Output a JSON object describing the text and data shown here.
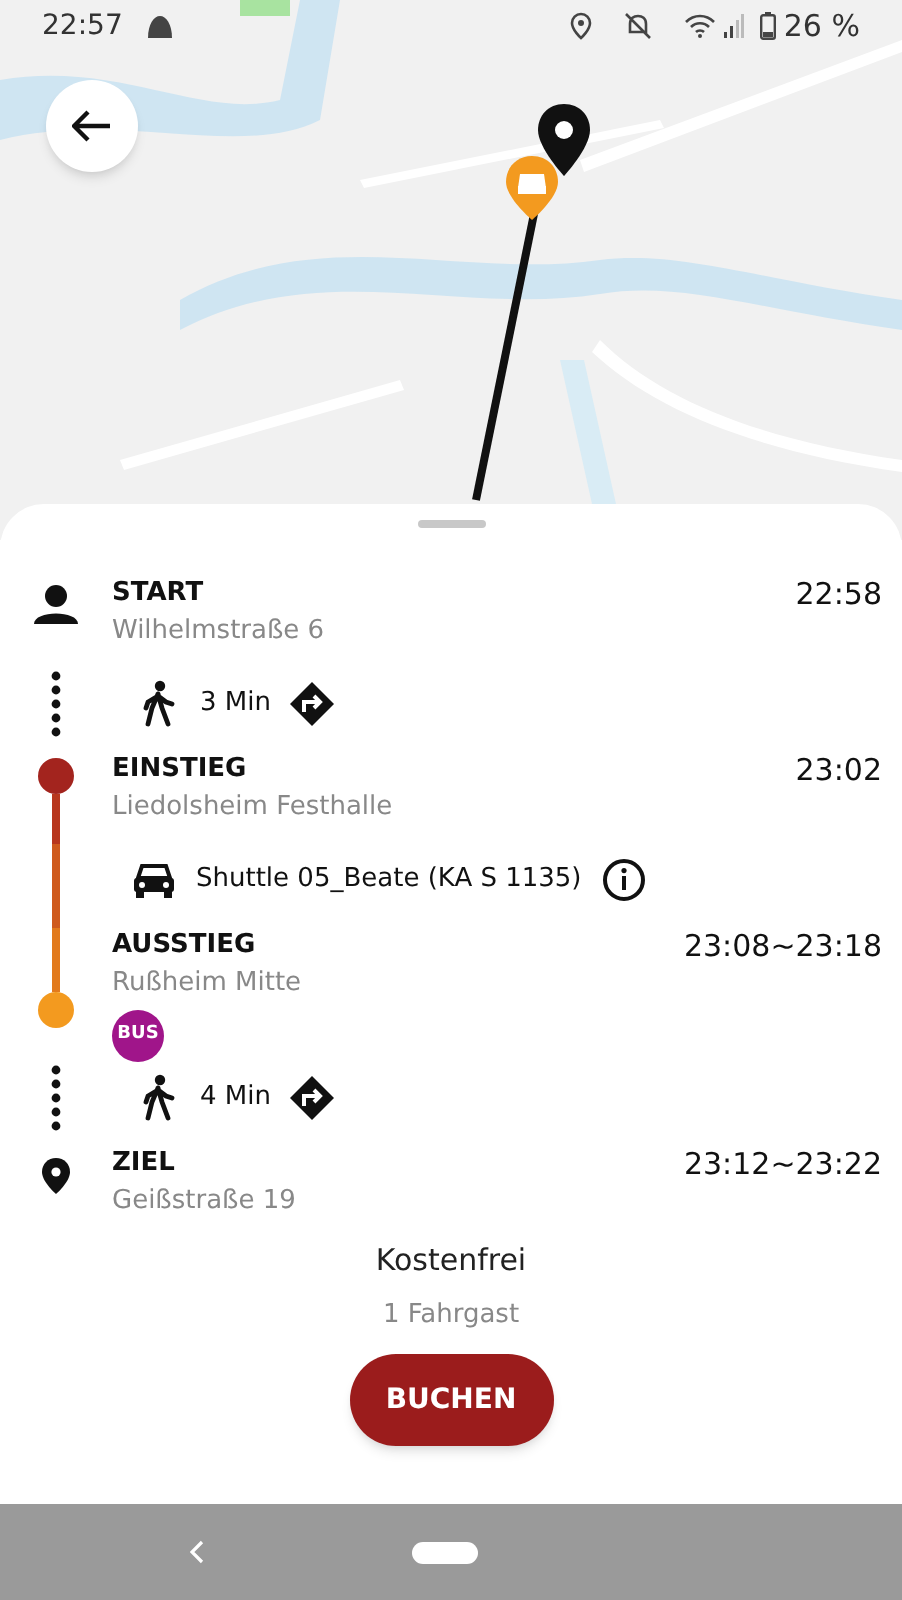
{
  "status_bar": {
    "time": "22:57",
    "battery": "26 %"
  },
  "itinerary": [
    {
      "kind": "start",
      "title": "START",
      "place": "Wilhelmstraße 6",
      "time": "22:58"
    },
    {
      "kind": "walk",
      "duration": "3 Min"
    },
    {
      "kind": "board",
      "title": "EINSTIEG",
      "place": "Liedolsheim Festhalle",
      "time": "23:02"
    },
    {
      "kind": "ride",
      "vehicle": "Shuttle 05_Beate (KA S 1135)"
    },
    {
      "kind": "alight",
      "title": "AUSSTIEG",
      "place": "Rußheim Mitte",
      "time": "23:08~23:18",
      "badge": "BUS"
    },
    {
      "kind": "walk",
      "duration": "4 Min"
    },
    {
      "kind": "destination",
      "title": "ZIEL",
      "place": "Geißstraße 19",
      "time": "23:12~23:22"
    }
  ],
  "price": "Kostenfrei",
  "passengers": "1 Fahrgast",
  "book_button": "BUCHEN"
}
